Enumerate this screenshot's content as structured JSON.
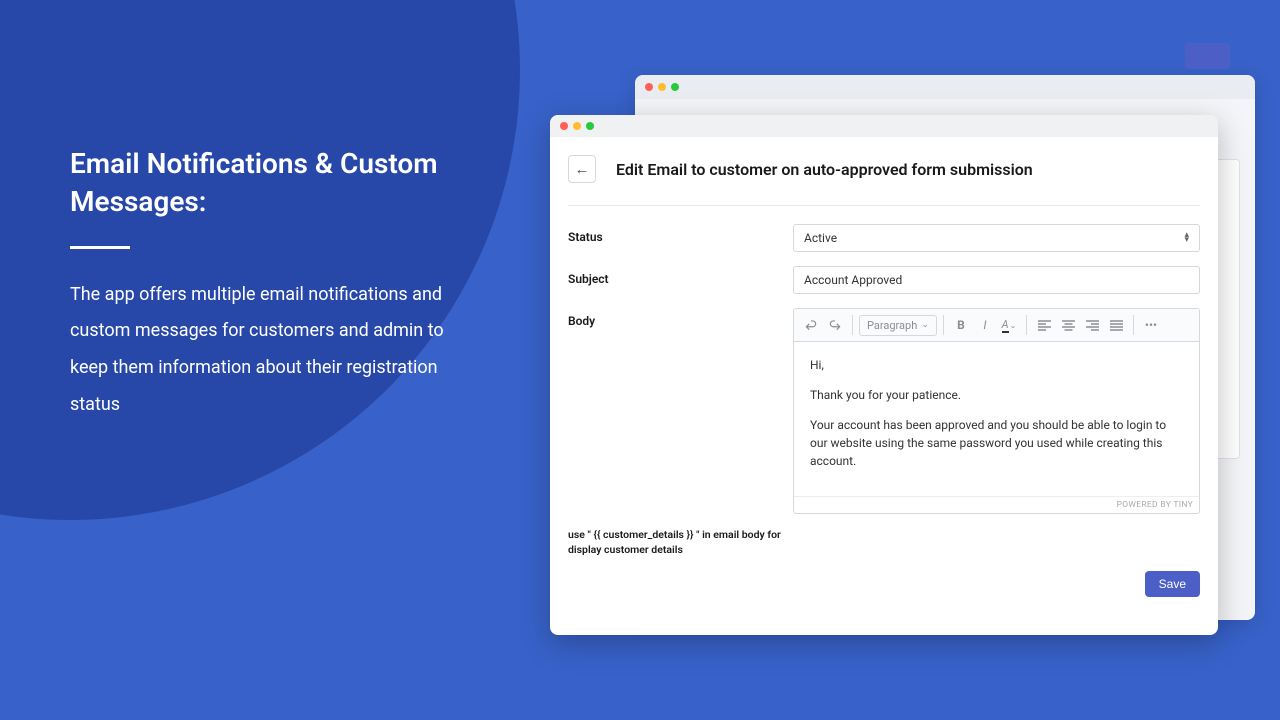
{
  "promo": {
    "heading": "Email Notifications & Custom Messages:",
    "description": "The app offers multiple email notifications and custom messages for customers and admin to keep them information about their registration status"
  },
  "editor": {
    "page_title": "Edit Email to customer on auto-approved form submission",
    "labels": {
      "status": "Status",
      "subject": "Subject",
      "body": "Body"
    },
    "values": {
      "status": "Active",
      "subject": "Account Approved"
    },
    "body_lines": {
      "l1": "Hi,",
      "l2": "Thank you for your patience.",
      "l3": "Your account has been approved and you should be able to login to our website using the same password you used while creating this account."
    },
    "toolbar": {
      "paragraph": "Paragraph"
    },
    "powered": "POWERED BY TINY",
    "hint": "use \" {{ customer_details }} \" in email body for display customer details",
    "save": "Save"
  }
}
